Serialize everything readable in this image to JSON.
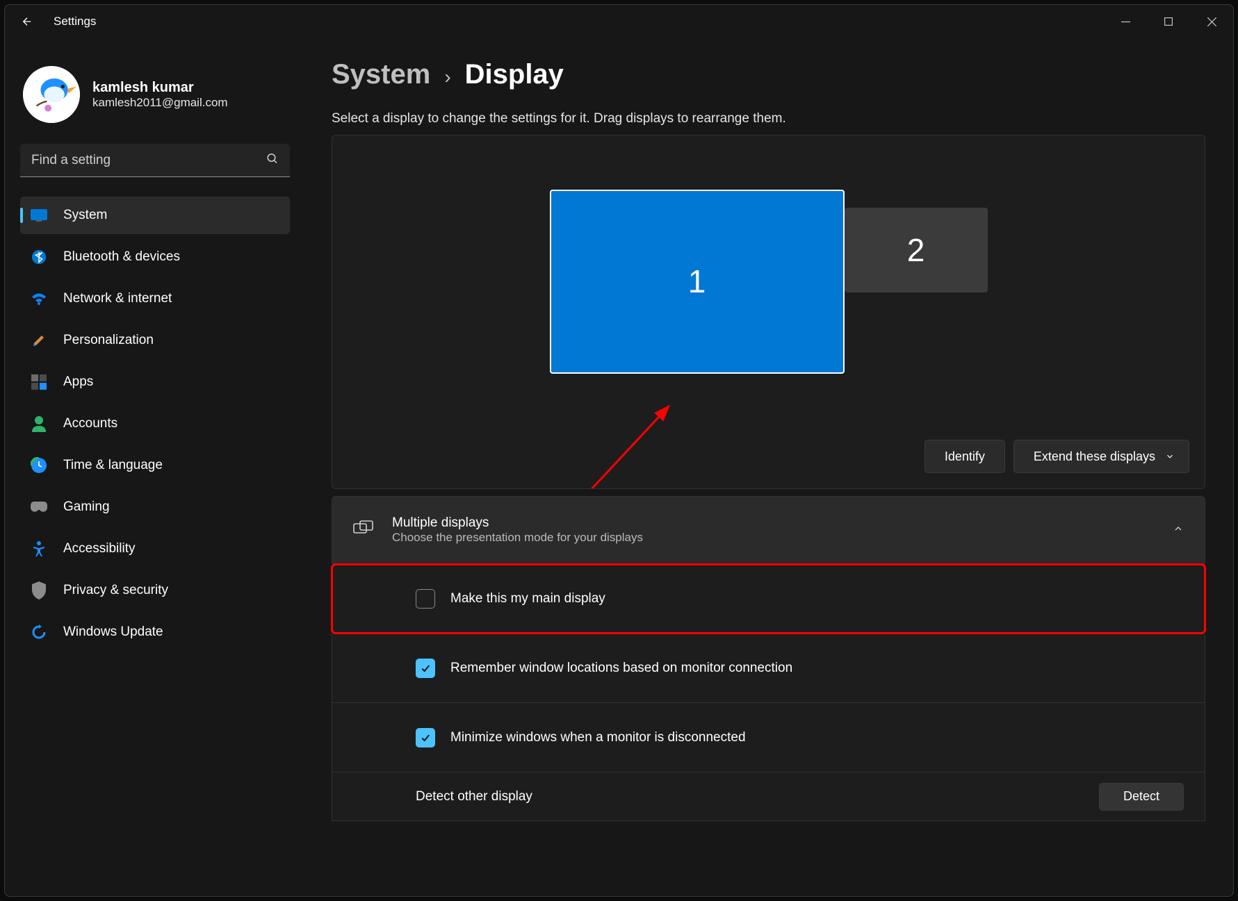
{
  "window": {
    "title": "Settings"
  },
  "profile": {
    "name": "kamlesh kumar",
    "email": "kamlesh2011@gmail.com"
  },
  "search": {
    "placeholder": "Find a setting"
  },
  "nav": {
    "items": [
      {
        "label": "System"
      },
      {
        "label": "Bluetooth & devices"
      },
      {
        "label": "Network & internet"
      },
      {
        "label": "Personalization"
      },
      {
        "label": "Apps"
      },
      {
        "label": "Accounts"
      },
      {
        "label": "Time & language"
      },
      {
        "label": "Gaming"
      },
      {
        "label": "Accessibility"
      },
      {
        "label": "Privacy & security"
      },
      {
        "label": "Windows Update"
      }
    ]
  },
  "breadcrumb": {
    "parent": "System",
    "current": "Display"
  },
  "caption": "Select a display to change the settings for it. Drag displays to rearrange them.",
  "displays": {
    "one": "1",
    "two": "2"
  },
  "buttons": {
    "identify": "Identify",
    "mode": "Extend these displays",
    "detect": "Detect"
  },
  "multi": {
    "title": "Multiple displays",
    "subtitle": "Choose the presentation mode for your displays"
  },
  "checks": {
    "main": "Make this my main display",
    "remember": "Remember window locations based on monitor connection",
    "minimize": "Minimize windows when a monitor is disconnected"
  },
  "detect_label": "Detect other display"
}
